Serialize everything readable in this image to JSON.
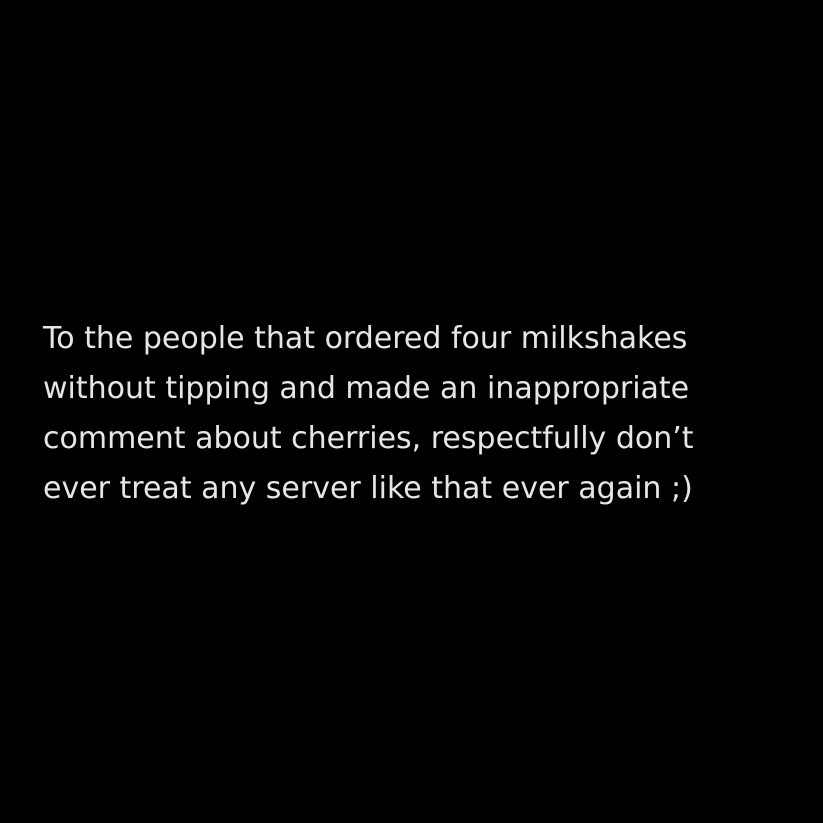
{
  "post": {
    "lines": [
      "To the people that ordered four milkshakes",
      "without tipping and made an inappropriate",
      "comment about cherries, respectfully don’t",
      "ever treat any server like that ever again ;)"
    ]
  },
  "colors": {
    "background": "#000000",
    "text": "#e6e6e6"
  }
}
